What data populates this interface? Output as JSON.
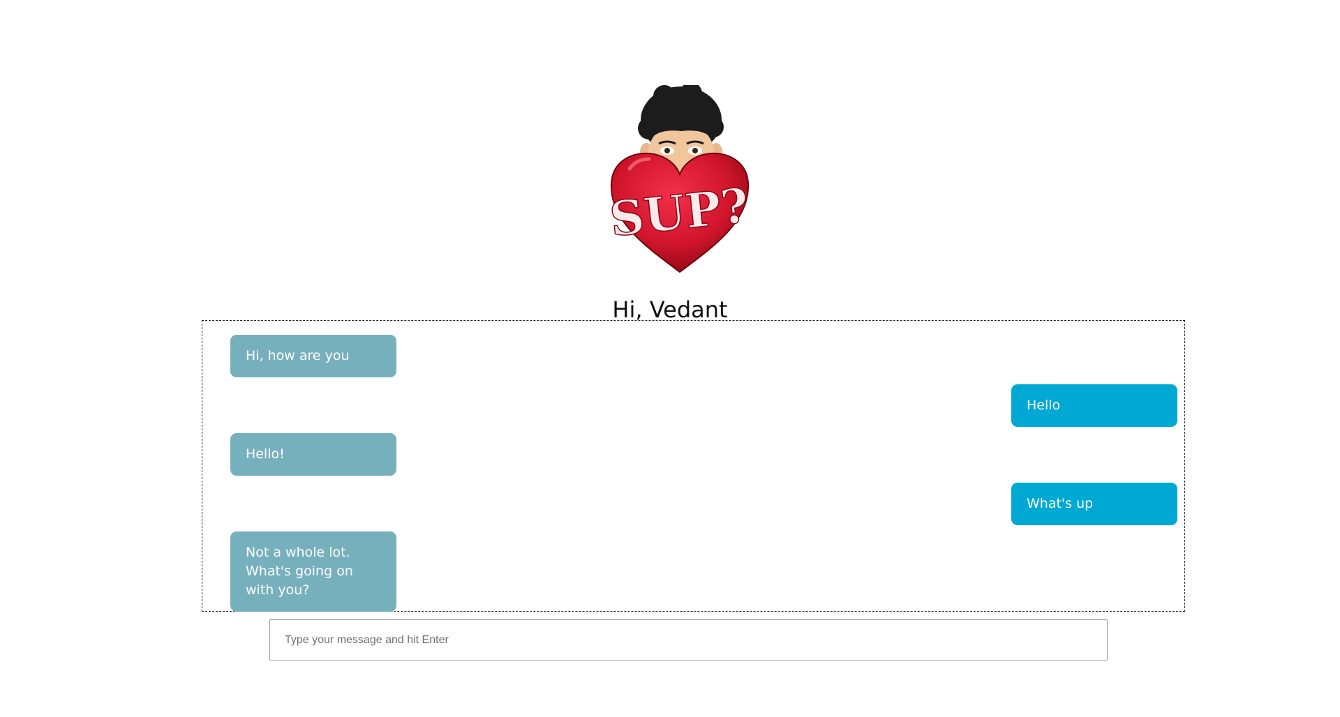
{
  "header": {
    "avatar_icon": "bitmoji-heart-avatar-icon",
    "avatar_text": "SUP?",
    "greeting": "Hi, Vedant"
  },
  "colors": {
    "bot_bubble": "#77b0bd",
    "user_bubble": "#00a9d3",
    "heart": "#d0152b"
  },
  "chat": {
    "messages": [
      {
        "sender": "bot",
        "text": "Hi, how are you"
      },
      {
        "sender": "user",
        "text": "Hello"
      },
      {
        "sender": "bot",
        "text": "Hello!"
      },
      {
        "sender": "user",
        "text": "What's up"
      },
      {
        "sender": "bot",
        "text": "Not a whole lot. What's going on with you?"
      }
    ]
  },
  "input": {
    "placeholder": "Type your message and hit Enter",
    "value": ""
  }
}
